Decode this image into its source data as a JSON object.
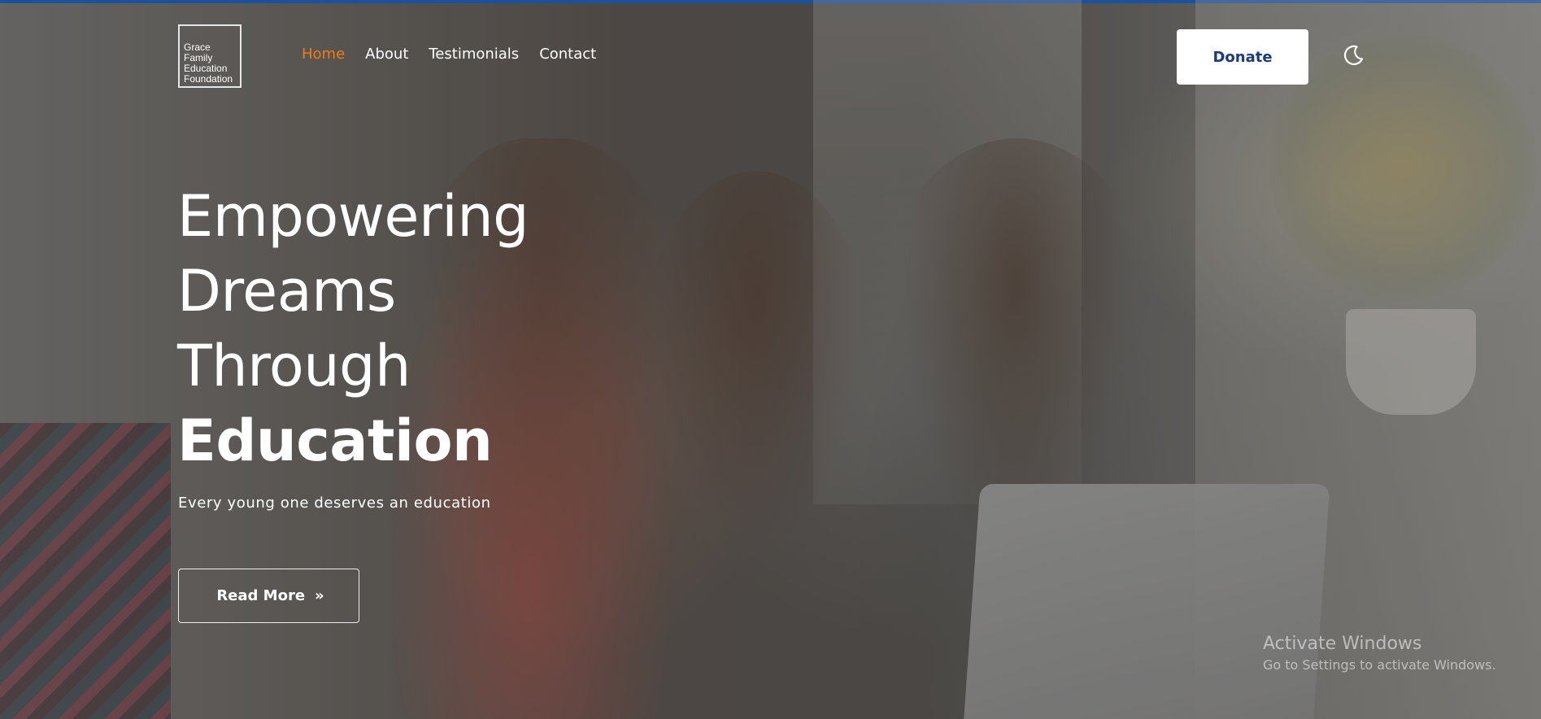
{
  "logo": {
    "lines": [
      "Grace",
      "Family",
      "Education",
      "Foundation"
    ]
  },
  "nav": {
    "items": [
      {
        "label": "Home",
        "active": true
      },
      {
        "label": "About",
        "active": false
      },
      {
        "label": "Testimonials",
        "active": false
      },
      {
        "label": "Contact",
        "active": false
      }
    ]
  },
  "header": {
    "donate_label": "Donate",
    "theme_icon": "moon-icon"
  },
  "hero": {
    "title_lines": [
      "Empowering",
      "Dreams",
      "Through"
    ],
    "title_emphasis": "Education",
    "subtitle": "Every young one deserves an education",
    "cta_label": "Read More",
    "cta_icon": "double-chevron-right-icon",
    "cta_icon_glyph": "»"
  },
  "watermark": {
    "title": "Activate Windows",
    "subtitle": "Go to Settings to activate Windows."
  },
  "colors": {
    "accent_active": "#f07a1c",
    "donate_text": "#1a3c7a",
    "top_bar": "#1f63c4"
  }
}
